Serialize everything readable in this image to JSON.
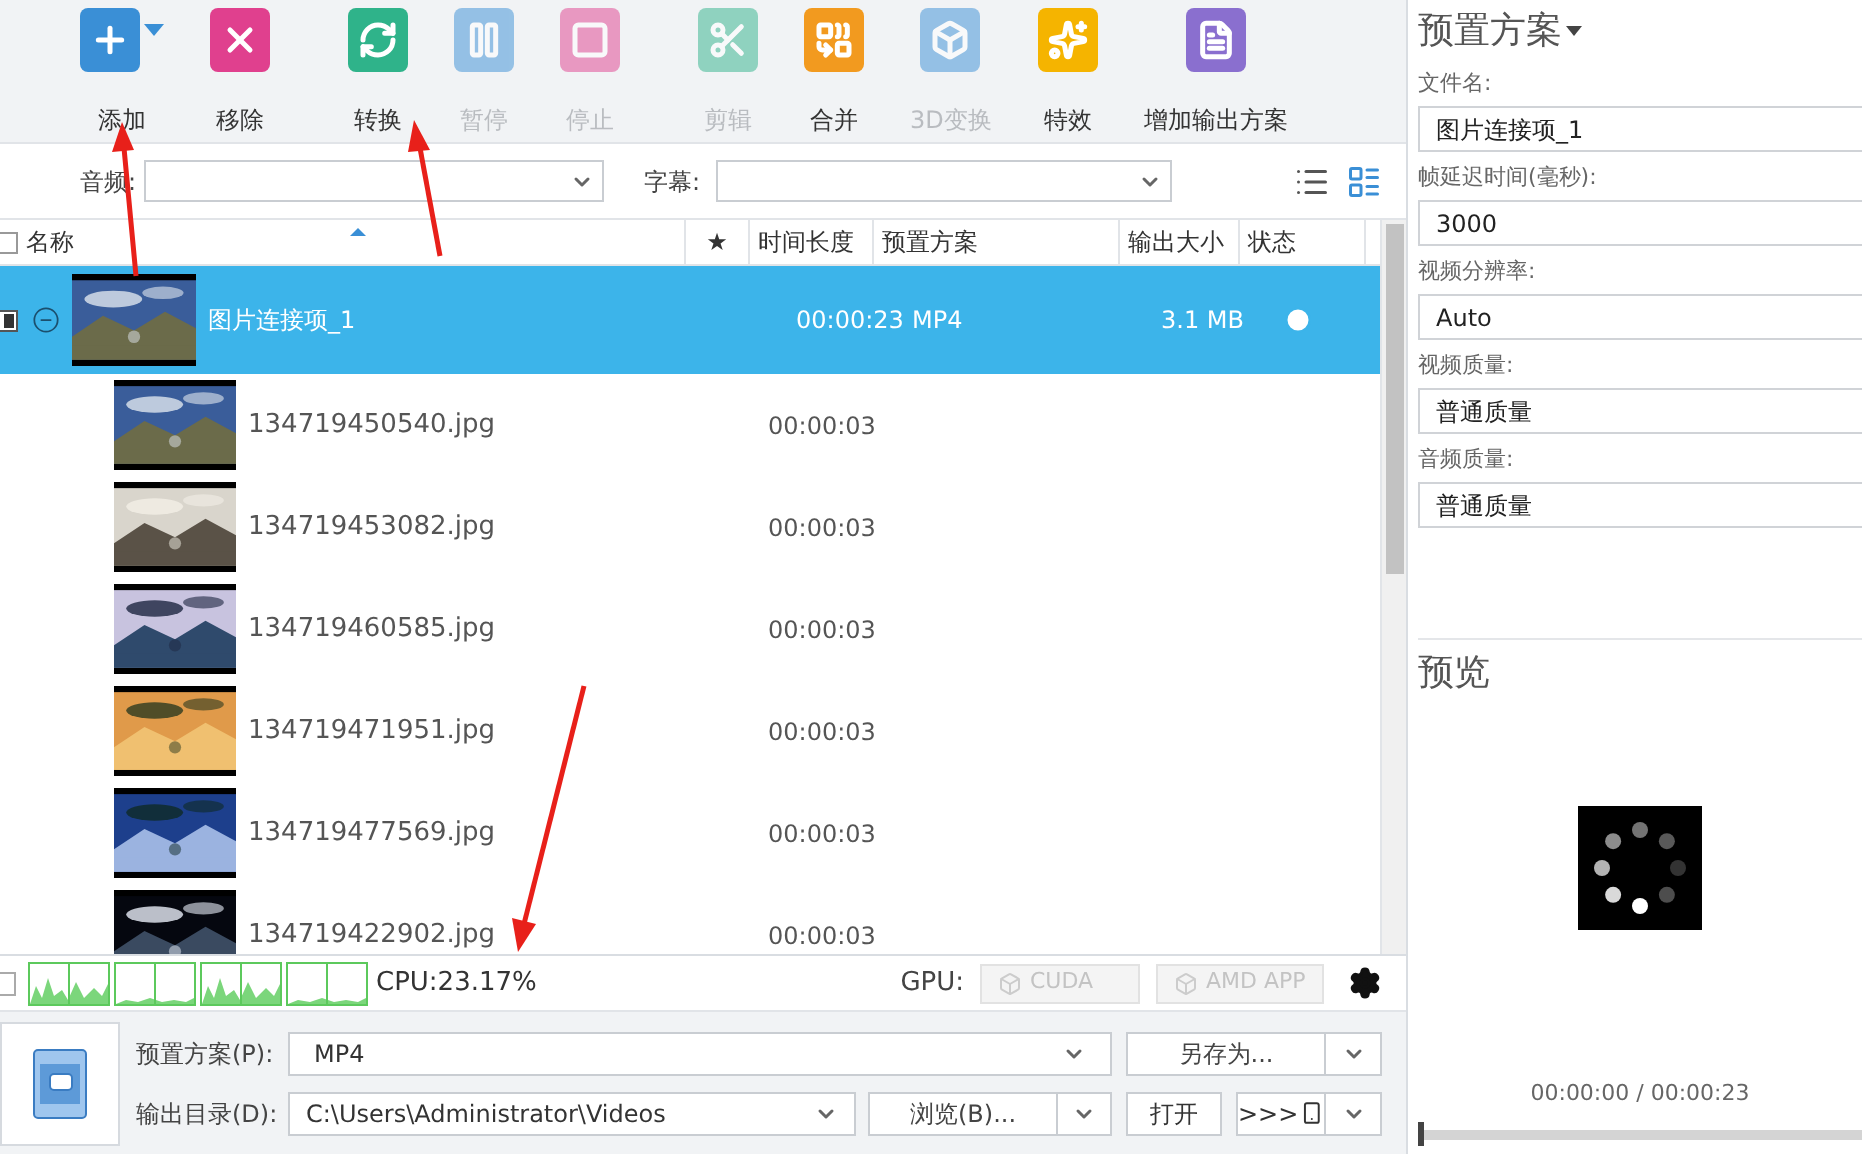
{
  "toolbar": [
    {
      "label": "添加",
      "kind": "add",
      "disabled": false,
      "dropdown": true
    },
    {
      "label": "移除",
      "kind": "remove",
      "disabled": false,
      "dropdown": false
    },
    {
      "label": "转换",
      "kind": "convert",
      "disabled": false,
      "dropdown": false
    },
    {
      "label": "暂停",
      "kind": "pause",
      "disabled": true,
      "dropdown": false
    },
    {
      "label": "停止",
      "kind": "stop",
      "disabled": true,
      "dropdown": false
    },
    {
      "label": "剪辑",
      "kind": "cut",
      "disabled": true,
      "dropdown": false
    },
    {
      "label": "合并",
      "kind": "merge",
      "disabled": false,
      "dropdown": false
    },
    {
      "label": "3D变换",
      "kind": "transform3d",
      "disabled": true,
      "dropdown": false
    },
    {
      "label": "特效",
      "kind": "effects",
      "disabled": false,
      "dropdown": false
    },
    {
      "label": "增加输出方案",
      "kind": "profile",
      "disabled": false,
      "dropdown": false
    }
  ],
  "filters": {
    "audio_label": "音频:",
    "subtitle_label": "字幕:"
  },
  "table": {
    "all_checked": false,
    "columns": [
      "名称",
      "★",
      "时间长度",
      "预置方案",
      "输出大小",
      "状态"
    ],
    "rows": [
      {
        "name": "图片连接项_1",
        "duration": "00:00:23",
        "preset": "MP4",
        "size": "3.1 MB",
        "checked": true,
        "selected": true,
        "expanded": true,
        "children": [
          {
            "name": "134719450540.jpg",
            "duration": "00:00:03"
          },
          {
            "name": "134719453082.jpg",
            "duration": "00:00:03"
          },
          {
            "name": "134719460585.jpg",
            "duration": "00:00:03"
          },
          {
            "name": "134719471951.jpg",
            "duration": "00:00:03"
          },
          {
            "name": "134719477569.jpg",
            "duration": "00:00:03"
          },
          {
            "name": "134719422902.jpg",
            "duration": "00:00:03"
          }
        ]
      }
    ]
  },
  "status_bar": {
    "cpu": "CPU:23.17%",
    "gpu_label": "GPU:",
    "cuda": {
      "label": "CUDA",
      "disabled": true
    },
    "amd": {
      "label": "AMD APP",
      "disabled": true
    }
  },
  "output": {
    "preset_label": "预置方案(P):",
    "preset_value": "MP4",
    "save_as": "另存为...",
    "dir_label": "输出目录(D):",
    "dir_value": "C:\\Users\\Administrator\\Videos",
    "browse": "浏览(B)...",
    "open": "打开",
    "send": ">>>"
  },
  "preset_panel": {
    "title": "预置方案",
    "fields": [
      {
        "label": "文件名:",
        "value": "图片连接项_1"
      },
      {
        "label": "帧延迟时间(毫秒):",
        "value": "3000"
      },
      {
        "label": "视频分辨率:",
        "value": "Auto"
      },
      {
        "label": "视频质量:",
        "value": "普通质量"
      },
      {
        "label": "音频质量:",
        "value": "普通质量"
      }
    ]
  },
  "preview": {
    "title": "预览",
    "time": "00:00:00 / 00:00:23",
    "level": 0
  }
}
